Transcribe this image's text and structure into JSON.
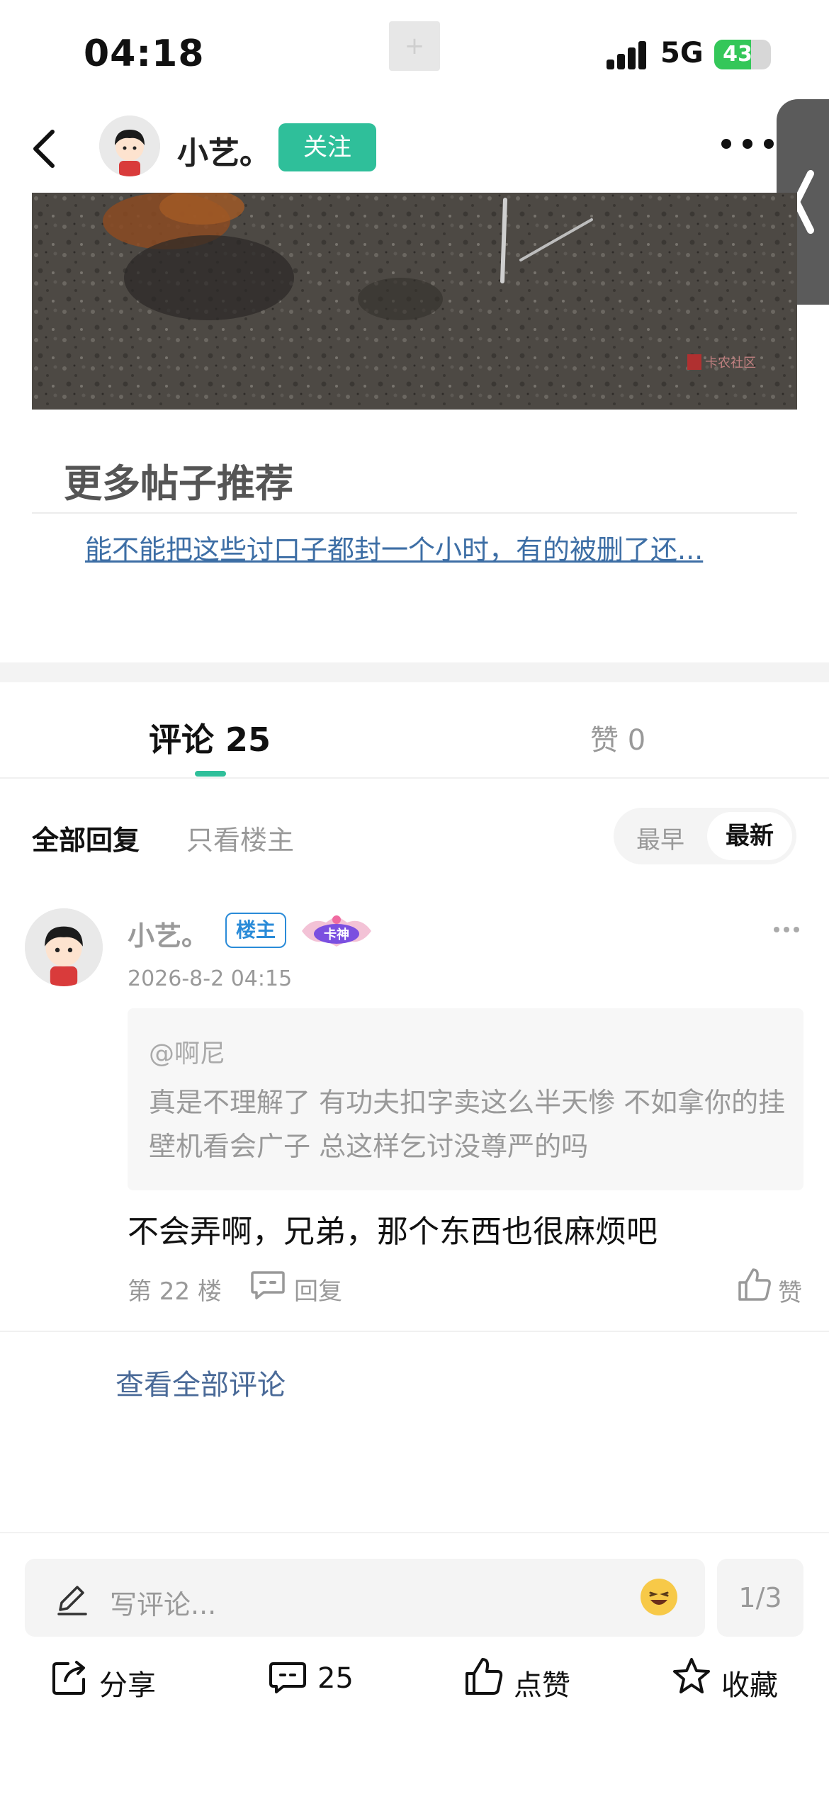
{
  "status_bar": {
    "time": "04:18",
    "network": "5G",
    "battery": "43",
    "center_indicator": "+"
  },
  "header": {
    "username": "小艺。",
    "follow_label": "关注"
  },
  "more_section": {
    "title": "更多帖子推荐",
    "recommended_post": "能不能把这些讨口子都封一个小时，有的被删了还..."
  },
  "photo": {
    "watermark": "卡农社区"
  },
  "tabs": {
    "comments": "评论 25",
    "likes": "赞 0"
  },
  "filters": {
    "all": "全部回复",
    "op_only": "只看楼主",
    "earliest": "最早",
    "newest": "最新"
  },
  "comment": {
    "author": "小艺。",
    "op_badge": "楼主",
    "title_badge": "卡神",
    "time": "2026-8-2 04:15",
    "quote_user": "@啊尼",
    "quote_text": "真是不理解了 有功夫扣字卖这么半天惨  不如拿你的挂壁机看会广子 总这样乞讨没尊严的吗",
    "body": "不会弄啊，兄弟，那个东西也很麻烦吧",
    "floor": "第 22 楼",
    "reply_label": "回复",
    "like_label": "赞"
  },
  "view_all": "查看全部评论",
  "input": {
    "placeholder": "写评论...",
    "pager": "1/3"
  },
  "bottom_bar": {
    "share": "分享",
    "comments": "25",
    "like": "点赞",
    "favorite": "收藏"
  },
  "colors": {
    "accent": "#2fbf9a",
    "link": "#3d6ea5",
    "badge_blue": "#2a8bd8"
  },
  "icons": [
    "back-icon",
    "more-icon",
    "side-chevron-icon",
    "reply-icon",
    "like-icon",
    "pen-icon",
    "emoji-icon",
    "share-icon",
    "comment-icon",
    "star-icon"
  ]
}
